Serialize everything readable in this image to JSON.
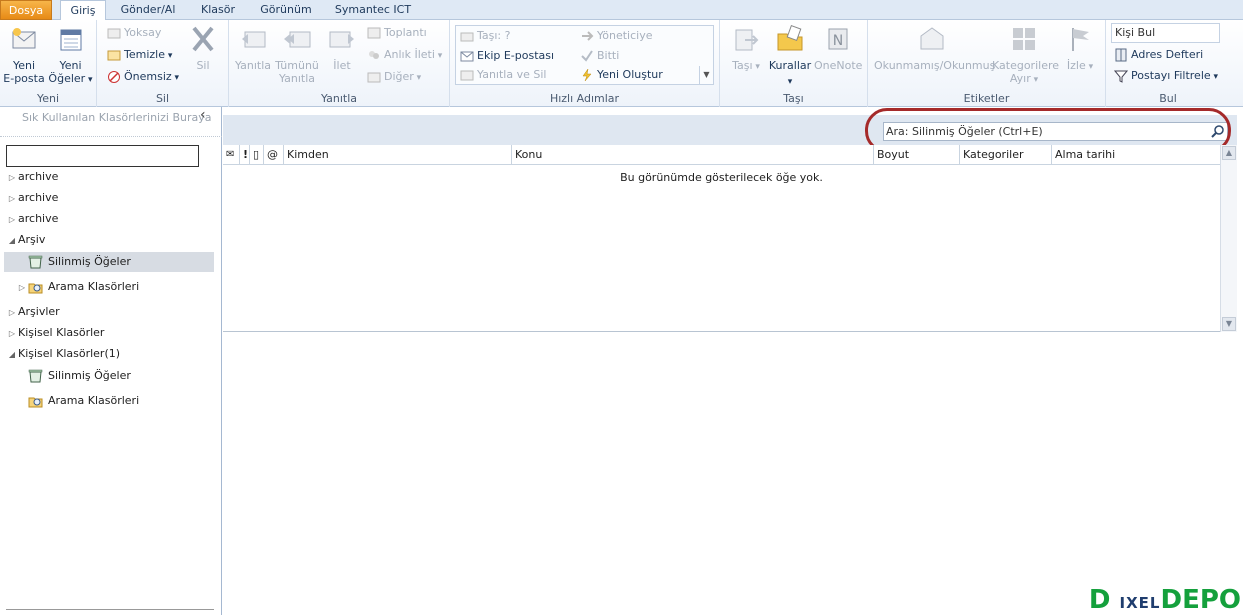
{
  "tabs": {
    "file": "Dosya",
    "home": "Giriş",
    "send_receive": "Gönder/Al",
    "folder": "Klasör",
    "view": "Görünüm",
    "symantec": "Symantec ICT"
  },
  "ribbon": {
    "new_group": {
      "label": "Yeni",
      "new_email": "Yeni\nE-posta",
      "new_items": "Yeni\nÖğeler"
    },
    "delete_group": {
      "label": "Sil",
      "ignore": "Yoksay",
      "clean_up": "Temizle",
      "junk": "Önemsiz",
      "delete": "Sil"
    },
    "reply_group": {
      "label": "Yanıtla",
      "reply": "Yanıtla",
      "reply_all": "Tümünü\nYanıtla",
      "forward": "İlet",
      "meeting": "Toplantı",
      "im": "Anlık İleti",
      "more": "Diğer"
    },
    "quick_steps_group": {
      "label": "Hızlı Adımlar",
      "move_to": "Taşı: ?",
      "team_email": "Ekip E-postası",
      "reply_delete": "Yanıtla ve Sil",
      "to_manager": "Yöneticiye",
      "done": "Bitti",
      "create_new": "Yeni Oluştur"
    },
    "move_group": {
      "label": "Taşı",
      "move": "Taşı",
      "rules": "Kurallar",
      "onenote": "OneNote"
    },
    "tags_group": {
      "label": "Etiketler",
      "unread_read": "Okunmamış/Okunmuş",
      "categorize": "Kategorilere\nAyır",
      "follow_up": "İzle"
    },
    "find_group": {
      "label": "Bul",
      "find_contact": "Kişi Bul",
      "address_book": "Adres Defteri",
      "filter_email": "Postayı Filtrele"
    }
  },
  "nav": {
    "favorites_hint": "Sık Kullanılan Klasörlerinizi Buraya",
    "search_value": "",
    "folders": [
      {
        "label": "archive",
        "arrow": "▷",
        "icon": "none"
      },
      {
        "label": "archive",
        "arrow": "▷",
        "icon": "none"
      },
      {
        "label": "archive",
        "arrow": "▷",
        "icon": "none"
      },
      {
        "label": "Arşiv",
        "arrow": "◢",
        "icon": "none"
      },
      {
        "label": "Silinmiş Öğeler",
        "arrow": "",
        "icon": "deleted-items-icon",
        "selected": true
      },
      {
        "label": "Arama Klasörleri",
        "arrow": "▷",
        "icon": "search-folder-icon"
      },
      {
        "label": "Arşivler",
        "arrow": "▷",
        "icon": "none"
      },
      {
        "label": "Kişisel Klasörler",
        "arrow": "▷",
        "icon": "none"
      },
      {
        "label": "Kişisel Klasörler(1)",
        "arrow": "◢",
        "icon": "none"
      },
      {
        "label": "Silinmiş Öğeler",
        "arrow": "",
        "icon": "deleted-items-icon"
      },
      {
        "label": "Arama Klasörleri",
        "arrow": "",
        "icon": "search-folder-icon"
      }
    ]
  },
  "main": {
    "search_placeholder": "Ara: Silinmiş Öğeler (Ctrl+E)",
    "columns": {
      "from": "Kimden",
      "subject": "Konu",
      "size": "Boyut",
      "categories": "Kategoriler",
      "received": "Alma tarihi"
    },
    "empty_message": "Bu görünümde gösterilecek öğe yok."
  },
  "watermark": {
    "left": "D",
    "mid": "IXEL",
    "right": "DEPO"
  },
  "colors": {
    "file_tab": "#e78a16",
    "highlight_ring": "#a52a2a",
    "ribbon_bg": "#eef3fa",
    "watermark_green": "#14a03c"
  }
}
